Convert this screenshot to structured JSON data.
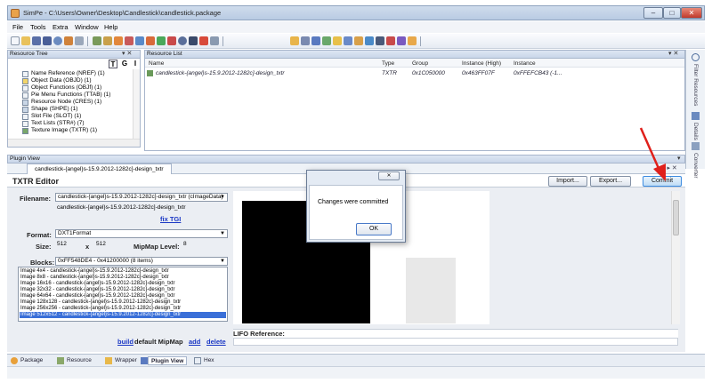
{
  "window": {
    "title": "SimPe - C:\\Users\\Owner\\Desktop\\Candlestick\\candlestick.package",
    "minimize": "–",
    "maximize": "□",
    "close": "✕"
  },
  "menu": [
    "File",
    "Tools",
    "Extra",
    "Window",
    "Help"
  ],
  "resource_tree": {
    "header": "Resource Tree",
    "controls": "▾ ✕",
    "buttons": [
      "T",
      "G",
      "I"
    ],
    "items": [
      "Name Reference (NREF) (1)",
      "Object Data (OBJD) (1)",
      "Object Functions (OBJf) (1)",
      "Pie Menu Functions (TTAB) (1)",
      "Resource Node (CRES) (1)",
      "Shape (SHPE) (1)",
      "Slot File (SLOT) (1)",
      "Text Lists (STR#) (7)",
      "Texture Image (TXTR) (1)"
    ]
  },
  "resource_list": {
    "header": "Resource List",
    "controls": "▾ ✕",
    "columns": [
      "Name",
      "Type",
      "Group",
      "Instance (High)",
      "Instance"
    ],
    "rows": [
      {
        "name": "candlestick-{angel}s-15.9.2012-1282c]-design_txtr",
        "type": "TXTR",
        "group": "0x1C050000",
        "instance_high": "0x463FF07F",
        "instance": "0xFFEFCB43 (-1..."
      }
    ]
  },
  "dock_tabs": [
    "Filter Resources",
    "Details",
    "Converter"
  ],
  "plugin_view": {
    "header": "Plugin View",
    "header_controls": "▾",
    "tab_label": "candlestick-{angel}s-15.9.2012-1282c]-design_txtr",
    "tab_controls": "◂ ▸ ✕"
  },
  "editor": {
    "title": "TXTR Editor",
    "buttons": {
      "import": "Import...",
      "export": "Export...",
      "commit": "Commit"
    },
    "filename_label": "Filename:",
    "filename_combo": "candlestick-{angel}s-15.9.2012-1282c]-design_txtr (cImageData)",
    "filename_text": "candlestick-{angel}s-15.9.2012-1282c]-design_txtr",
    "fix_tgi": "fix TGI",
    "format_label": "Format:",
    "format_value": "DXT1Format",
    "size_label": "Size:",
    "size_w": "512",
    "size_x": "x",
    "size_h": "512",
    "mipmap_label": "MipMap Level:",
    "mipmap_value": "8",
    "blocks_label": "Blocks:",
    "blocks_value": "0xFF548DE4 - 0x41200000 (8 items)",
    "block_items": [
      "Image 4x4 - candlestick-{angel}s-15.9.2012-1282c]-design_txtr",
      "Image 8x8 - candlestick-{angel}s-15.9.2012-1282c]-design_txtr",
      "Image 16x16 - candlestick-{angel}s-15.9.2012-1282c]-design_txtr",
      "Image 32x32 - candlestick-{angel}s-15.9.2012-1282c]-design_txtr",
      "Image 64x64 - candlestick-{angel}s-15.9.2012-1282c]-design_txtr",
      "Image 128x128 - candlestick-{angel}s-15.9.2012-1282c]-design_txtr",
      "Image 256x256 - candlestick-{angel}s-15.9.2012-1282c]-design_txtr",
      "Image 512x512 - candlestick-{angel}s-15.9.2012-1282c]-design_txtr"
    ],
    "links": {
      "build": "build",
      "default_mipmap": "default MipMap",
      "add": "add",
      "delete": "delete"
    },
    "lifo_label": "LIFO Reference:"
  },
  "dialog": {
    "close": "✕",
    "message": "Changes were committed",
    "ok": "OK"
  },
  "bottom_tabs": [
    "Package",
    "Resource",
    "Wrapper",
    "Plugin View",
    "Hex"
  ],
  "colors": {
    "accent": "#3a6fd8",
    "annotation_arrow": "#e0201b",
    "link": "#1a37c4"
  }
}
